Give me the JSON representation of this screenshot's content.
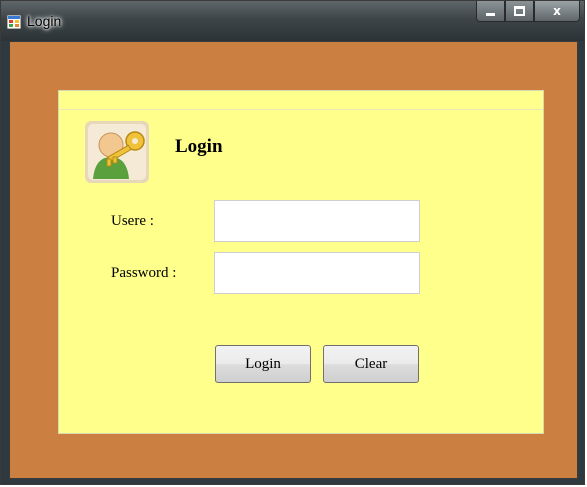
{
  "window": {
    "title": "Login",
    "controls": {
      "minimize": "▁",
      "maximize": "□",
      "close": "x"
    },
    "icon": "app-form-icon"
  },
  "form": {
    "heading": "Login",
    "avatar_icon": "user-key-icon",
    "user_label": "Usere :",
    "user_value": "",
    "password_label": "Password :",
    "password_value": "",
    "login_button": "Login",
    "clear_button": "Clear"
  },
  "colors": {
    "client_bg": "#cb7f40",
    "panel_bg": "#ffff8c",
    "titlebar": "#3d4548"
  }
}
